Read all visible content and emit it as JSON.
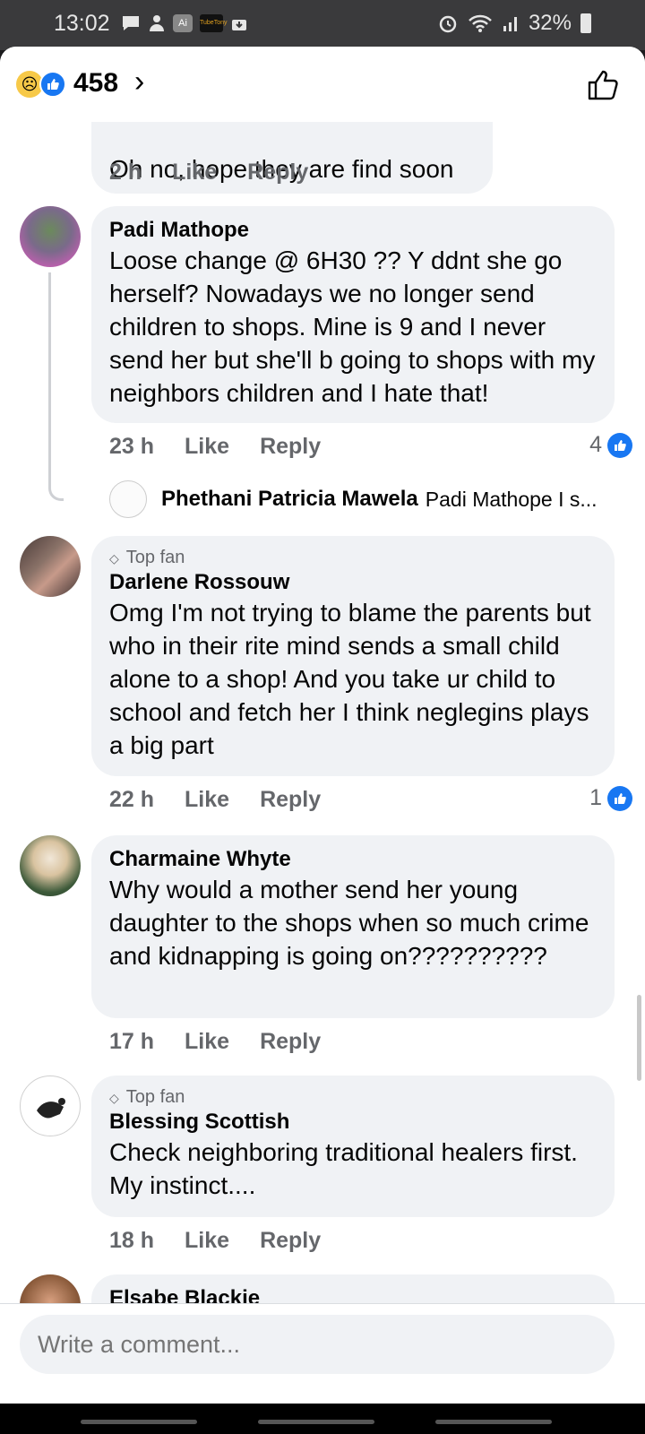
{
  "status_bar": {
    "time": "13:02",
    "battery": "32%",
    "left_icons": [
      "chat-icon",
      "person-icon",
      "ai-icon",
      "tv-icon",
      "download-icon"
    ],
    "right_icons": [
      "alarm-icon",
      "wifi-icon",
      "signal-icon",
      "battery-icon"
    ],
    "ai_label": "Ai",
    "tv_label": "TubeTony"
  },
  "header": {
    "reaction_count": "458",
    "reactions": [
      "sad-reaction",
      "like-reaction"
    ]
  },
  "partial_comment": {
    "text": "Oh no, hope they are find soon",
    "time": "2 h",
    "like": "Like",
    "reply": "Reply"
  },
  "comments": [
    {
      "name": "Padi Mathope",
      "top_fan": "",
      "text": "Loose change @ 6H30 ?? Y ddnt she go herself? Nowadays we no longer send children to shops. Mine is 9 and I never send her but she'll b going to shops with my neighbors children and I hate that!",
      "time": "23 h",
      "like": "Like",
      "reply": "Reply",
      "likes": "4",
      "reply_preview": {
        "name": "Phethani Patricia Mawela",
        "snippet": "Padi Mathope I s..."
      }
    },
    {
      "name": "Darlene Rossouw",
      "top_fan": "Top fan",
      "text": "Omg I'm not trying to blame the parents but who in their rite mind sends a small child alone to a shop! And you take ur child to school and fetch her I think neglegins plays a big part",
      "time": "22 h",
      "like": "Like",
      "reply": "Reply",
      "likes": "1"
    },
    {
      "name": "Charmaine Whyte",
      "top_fan": "",
      "text": "Why would a mother send her young daughter to the shops when so much crime and kidnapping is going on??????????",
      "time": "17 h",
      "like": "Like",
      "reply": "Reply"
    },
    {
      "name": "Blessing Scottish",
      "top_fan": "Top fan",
      "text": "Check neighboring traditional healers first. My instinct....",
      "time": "18 h",
      "like": "Like",
      "reply": "Reply"
    },
    {
      "name": "Elsabe Blackie"
    }
  ],
  "composer": {
    "placeholder": "Write a comment..."
  },
  "colors": {
    "brand_blue": "#1877f2",
    "bubble": "#f0f2f5",
    "secondary_text": "#65676b"
  }
}
